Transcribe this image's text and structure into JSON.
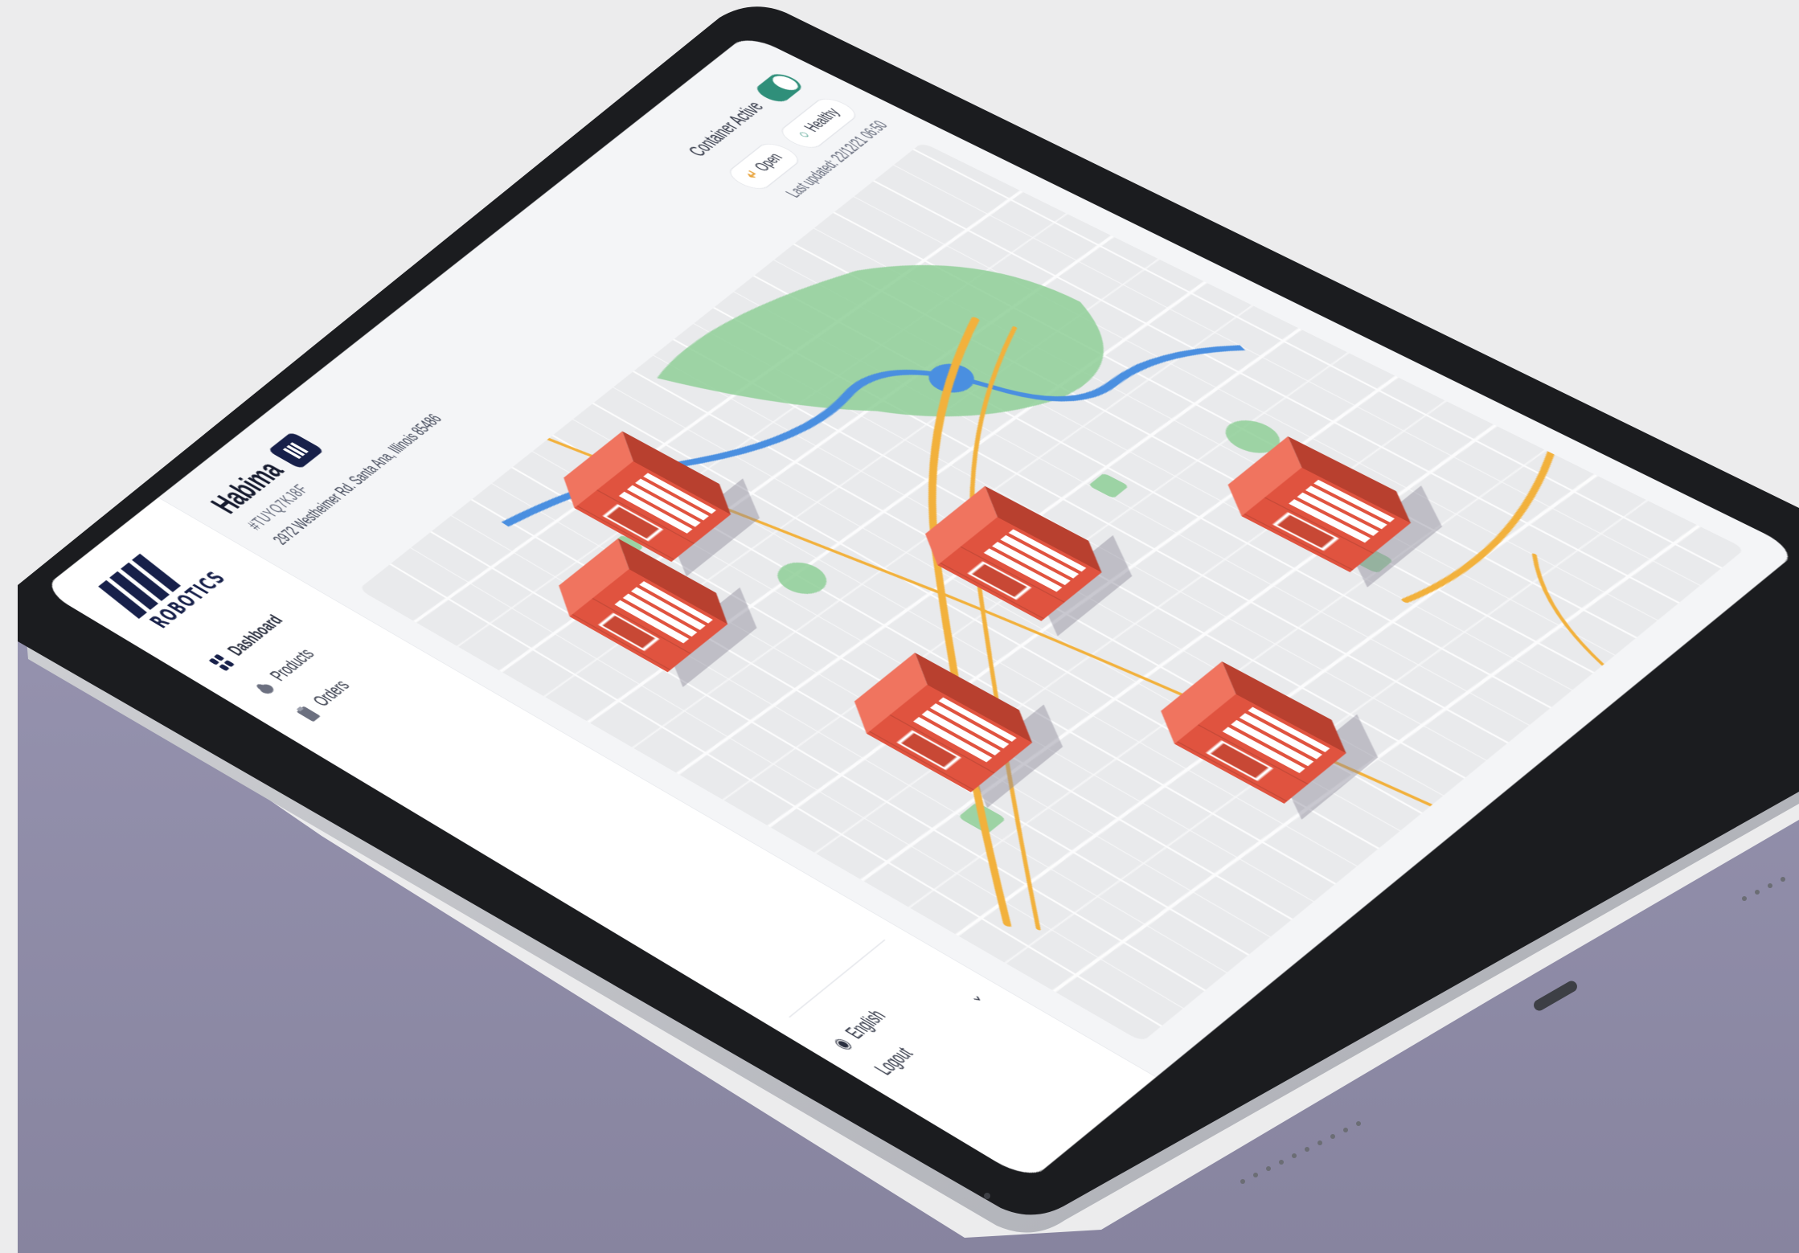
{
  "brand": {
    "logo_text": "ROBOTICS"
  },
  "sidebar": {
    "items": [
      {
        "label": "Dashboard",
        "icon": "grid-icon"
      },
      {
        "label": "Products",
        "icon": "cloud-icon"
      },
      {
        "label": "Orders",
        "icon": "clipboard-icon"
      }
    ],
    "language": "English",
    "logout": "Logout"
  },
  "site": {
    "name": "Habima",
    "id": "#TUYQ7KJ8F",
    "address": "2972 Westheimer Rd. Santa Ana, Illinois 85486"
  },
  "status": {
    "toggle_label": "Container Active",
    "toggle_on": true,
    "open_label": "Open",
    "health_label": "Healthy",
    "last_updated": "Last updated: 22/12/21 06:50"
  },
  "map": {
    "container_count": 6,
    "container_color": "#e0533f",
    "park_color": "#7cc58a",
    "road_color": "#f2b13c",
    "water_color": "#4a8fe0"
  },
  "colors": {
    "brand": "#17204a",
    "accent": "#2f8f7a",
    "background": "#ececed",
    "floor": "#8a87a3"
  }
}
